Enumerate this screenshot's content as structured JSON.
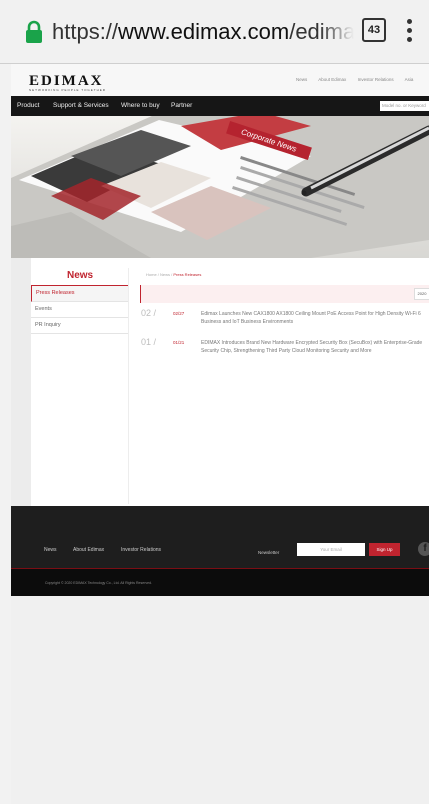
{
  "browser": {
    "url_prefix": "https://",
    "url_host": "www.edimax.com",
    "url_path": "/edimax/ca",
    "tab_count": "43"
  },
  "site": {
    "logo_text": "EDIMAX",
    "logo_sub": "NETWORKING PEOPLE TOGETHER",
    "toplinks": [
      "News",
      "About Edimax",
      "Investor Relations",
      "Asia"
    ],
    "nav": [
      "Product",
      "Support & Services",
      "Where to buy",
      "Partner"
    ],
    "search_placeholder": "Model no. or Keyword"
  },
  "hero": {
    "label": "Corporate News"
  },
  "sidebar": {
    "title": "News",
    "items": [
      {
        "label": "Press Releases",
        "active": true
      },
      {
        "label": "Events",
        "active": false
      },
      {
        "label": "PR Inquiry",
        "active": false
      }
    ]
  },
  "breadcrumb": {
    "path": "Home / News / ",
    "current": "Press Releases"
  },
  "filter": {
    "selected": "2020"
  },
  "news": [
    {
      "num": "02 /",
      "date": "02/27",
      "title": "Edimax Launches New CAX1800 AX1800 Ceiling Mount PoE Access Point for High Density Wi-Fi 6 Business and IoT Business Environments"
    },
    {
      "num": "01 /",
      "date": "01/21",
      "title": "EDIMAX Introduces Brand New Hardware Encrypted Security Box (SecuBox) with Enterprise-Grade Security Chip, Strengthening Third Party Cloud Monitoring Security and More"
    }
  ],
  "footer": {
    "links": [
      "News",
      "About Edimax",
      "Investor Relations"
    ],
    "newsletter_label": "Newsletter",
    "newsletter_placeholder": "Your Email",
    "signup_label": "Sign Up",
    "facebook": "f",
    "copyright": "Copyright © 2020 EDIMAX Technology Co., Ltd. All Rights Reserved."
  },
  "colors": {
    "accent": "#c0242f",
    "navbar": "#161616",
    "footer": "#1e1e1e"
  }
}
